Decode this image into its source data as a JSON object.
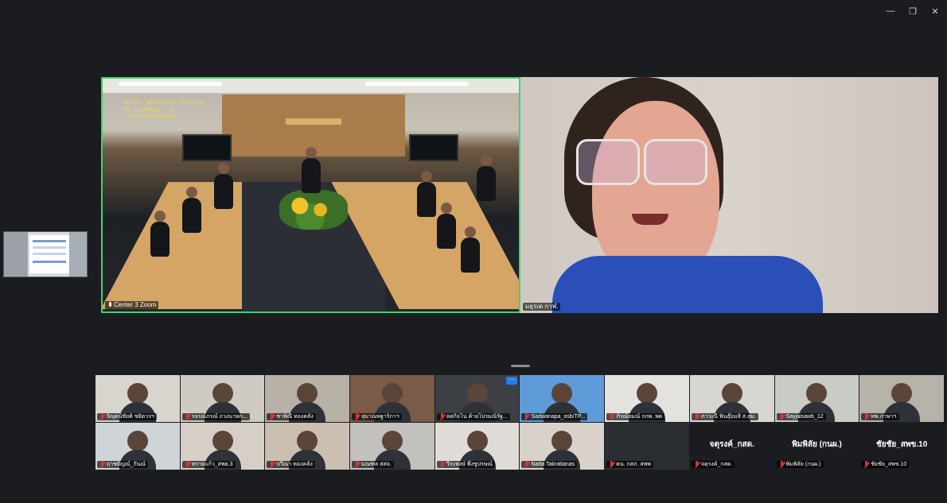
{
  "window": {
    "controls": {
      "minimize": "—",
      "restore": "❐",
      "close": "✕"
    }
  },
  "main": {
    "room_tile": {
      "name": "Center 3 Zoom",
      "overlay_lines": [
        "MODE: SEAMLESS MATRIX",
        "RX CHANNEL: 1",
        "1920X1080@60Hz"
      ],
      "mic": "on"
    },
    "speaker_tile": {
      "name": "มยุรเด กาฬ.",
      "mic": "on"
    }
  },
  "gallery": {
    "tiles": [
      {
        "label": "จิญุตน์ชัยติ ชยิตวรฯ",
        "mic": "off",
        "kind": "video",
        "bg": "#d8d4ce"
      },
      {
        "label": "รจรณ์ภรณ์ ถวงนาษก...",
        "mic": "off",
        "kind": "video",
        "bg": "#cfcac3"
      },
      {
        "label": "ชาพิณี ทองคลัง",
        "mic": "off",
        "kind": "video",
        "bg": "#b8b1a8"
      },
      {
        "label": "สุมาณพฐาริกาฯ",
        "mic": "off",
        "kind": "video",
        "bg": "#7a5a48"
      },
      {
        "label": "ลดกิจโน่ ค้ายโปรมณิรัฐ...",
        "mic": "off",
        "kind": "video",
        "bg": "#3c3f44",
        "more": "···"
      },
      {
        "label": "Sadwanapa_osb/TP...",
        "mic": "off",
        "kind": "video",
        "bg": "#5f9bd8"
      },
      {
        "label": "ภิรณ์ยมณ์ กกพ. พด",
        "mic": "off",
        "kind": "video",
        "bg": "#e4e2de"
      },
      {
        "label": "ภาวะนี ฟินธุ๊ยมสิ ส.สุม.",
        "mic": "off",
        "kind": "video",
        "bg": "#d8d6d0"
      },
      {
        "label": "Sayjaisawb_12",
        "mic": "off",
        "kind": "video",
        "bg": "#c9ccc5"
      },
      {
        "label": "ทพ.ภาษาฯ",
        "mic": "off",
        "kind": "video",
        "bg": "#b7b2aa"
      },
      {
        "label": "ฤาชยัญณ์_กันณ์",
        "mic": "off",
        "kind": "video",
        "bg": "#cfd4d8"
      },
      {
        "label": "ทรายแก้ว_สพย.3",
        "mic": "off",
        "kind": "video",
        "bg": "#d5cfc7"
      },
      {
        "label": "ปวีณา ทองคลัง",
        "mic": "off",
        "kind": "video",
        "bg": "#cbbfb2"
      },
      {
        "label": "มณฑล สสจ.",
        "mic": "off",
        "kind": "video",
        "bg": "#c3c1bd"
      },
      {
        "label": "วีระพงษ์ พึงชูปรษณ์",
        "mic": "off",
        "kind": "video",
        "bg": "#e0ddd8"
      },
      {
        "label": "Natta Takrattanas",
        "mic": "off",
        "kind": "video",
        "bg": "#d8d2cb"
      },
      {
        "label": "ตน. กสภ. สพพ",
        "mic": "off",
        "kind": "video",
        "bg": "#2a2d31"
      },
      {
        "label": "จตุรงค์_กสด.",
        "mic": "off",
        "kind": "name",
        "big": "จตุรงค์_กสด."
      },
      {
        "label": "พิมพิลัย (กนผ.)",
        "mic": "off",
        "kind": "name",
        "big": "พิมพิลัย (กนผ.)"
      },
      {
        "label": "ชัยชัย_สพข.10",
        "mic": "off",
        "kind": "name",
        "big": "ชัยชัย_สพข.10"
      }
    ]
  },
  "colors": {
    "background": "#1a1c1f",
    "active_speaker_border": "#3ad66b",
    "muted_icon": "#e0332c"
  }
}
